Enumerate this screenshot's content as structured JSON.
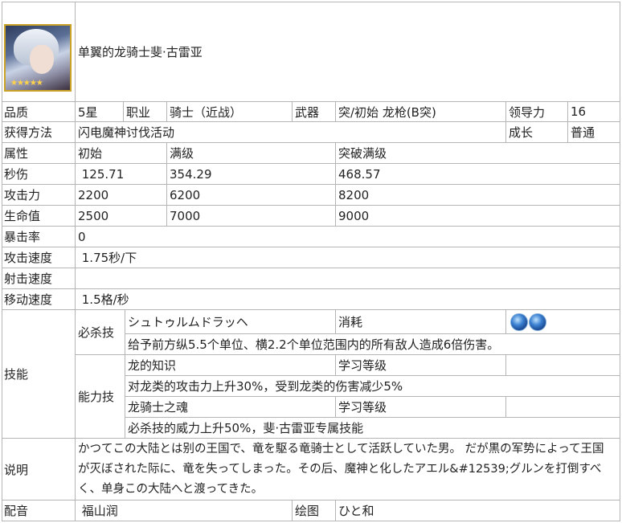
{
  "header": {
    "title": "单翼的龙骑士斐·古雷亚",
    "stars": "★★★★★"
  },
  "row1": {
    "quality_label": "品质",
    "quality_value": "5星",
    "job_label": "职业",
    "job_value": "骑士（近战）",
    "weapon_label": "武器",
    "weapon_value": "突/初始 龙枪(B突)",
    "leadership_label": "领导力",
    "leadership_value": "16"
  },
  "row2": {
    "obtain_label": "获得方法",
    "obtain_value": "闪电魔神讨伐活动",
    "growth_label": "成长",
    "growth_value": "普通"
  },
  "stats_header": {
    "attr": "属性",
    "initial": "初始",
    "max": "满级",
    "awaken": "突破满级"
  },
  "stats": {
    "dps": {
      "label": "秒伤",
      "initial": " 125.71",
      "max": "354.29",
      "awaken": "468.57"
    },
    "atk": {
      "label": "攻击力",
      "initial": "2200",
      "max": "6200",
      "awaken": "8200"
    },
    "hp": {
      "label": "生命值",
      "initial": "2500",
      "max": "7000",
      "awaken": "9000"
    }
  },
  "crit": {
    "label": "暴击率",
    "value": "0"
  },
  "atk_speed": {
    "label": "攻击速度",
    "value": " 1.75秒/下"
  },
  "shoot_speed": {
    "label": "射击速度",
    "value": ""
  },
  "move_speed": {
    "label": "移动速度",
    "value": " 1.5格/秒"
  },
  "skills": {
    "label": "技能",
    "ultimate_label": "必杀技",
    "ultimate_name": "シュトゥルムドラッヘ",
    "cost_label": "消耗",
    "cost_orb_count": 2,
    "ultimate_desc": "给予前方纵5.5个单位、横2.2个单位范围内的所有敌人造成6倍伤害。",
    "ability_label": "能力技",
    "ability1_name": "龙的知识",
    "ability1_level_label": "学习等级",
    "ability1_level_value": "",
    "ability1_desc": "对龙类的攻击力上升30%，受到龙类的伤害减少5%",
    "ability2_name": "龙骑士之魂",
    "ability2_level_label": "学习等级",
    "ability2_level_value": "",
    "ability2_desc": "必杀技的威力上升50%，斐·古雷亚专属技能"
  },
  "description": {
    "label": "说明",
    "text": " かつてこの大陆とは别の王国で、竜を駆る竜骑士として活跃していた男。 だが黒の军势によって王国が灭ぼされた际に、竜を失ってしまった。その后、魔神と化したアエル&#12539;グルンを打倒すべく、单身この大陆へと渡ってきた。"
  },
  "credits": {
    "voice_label": "配音",
    "voice_value": " 福山润",
    "art_label": "绘图",
    "art_value": "ひと和"
  }
}
